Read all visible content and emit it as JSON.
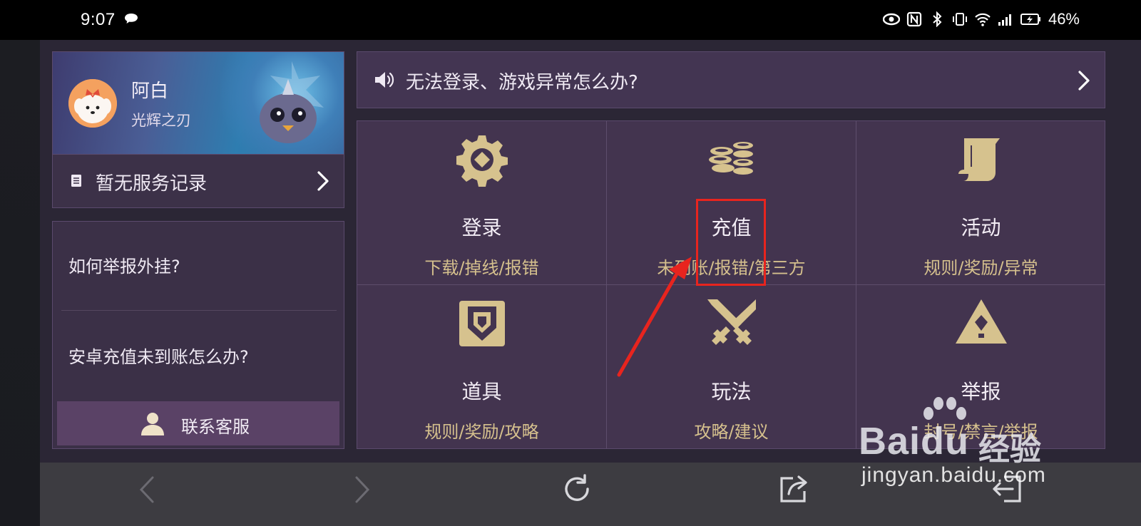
{
  "status_bar": {
    "time": "9:07",
    "battery": "46%",
    "icons": [
      "chat-icon",
      "eye-icon",
      "nfc-icon",
      "bluetooth-icon",
      "vibrate-icon",
      "wifi-icon",
      "4g-signal-icon",
      "battery-charging-icon"
    ]
  },
  "profile": {
    "name": "阿白",
    "server": "光辉之刃",
    "record_label": "暂无服务记录"
  },
  "faq": {
    "items": [
      "如何举报外挂?",
      "安卓充值未到账怎么办?"
    ],
    "contact_label": "联系客服"
  },
  "notice": {
    "text": "无法登录、游戏异常怎么办?"
  },
  "categories": [
    {
      "title": "登录",
      "sub": "下载/掉线/报错",
      "icon": "gear-icon"
    },
    {
      "title": "充值",
      "sub": "未到账/报错/第三方",
      "icon": "coins-icon"
    },
    {
      "title": "活动",
      "sub": "规则/奖励/异常",
      "icon": "scroll-icon"
    },
    {
      "title": "道具",
      "sub": "规则/奖励/攻略",
      "icon": "item-icon"
    },
    {
      "title": "玩法",
      "sub": "攻略/建议",
      "icon": "swords-icon"
    },
    {
      "title": "举报",
      "sub": "封号/禁言/举报",
      "icon": "warning-icon"
    }
  ],
  "colors": {
    "accent_gold": "#d6c28e",
    "panel": "#43344f",
    "highlight_red": "#e8241e"
  },
  "watermark": {
    "brand": "Baidu",
    "brand_cn": "经验",
    "url": "jingyan.baidu.com"
  },
  "navbar": {
    "icons": [
      "back-icon",
      "forward-icon",
      "refresh-icon",
      "share-icon",
      "exit-icon"
    ]
  }
}
